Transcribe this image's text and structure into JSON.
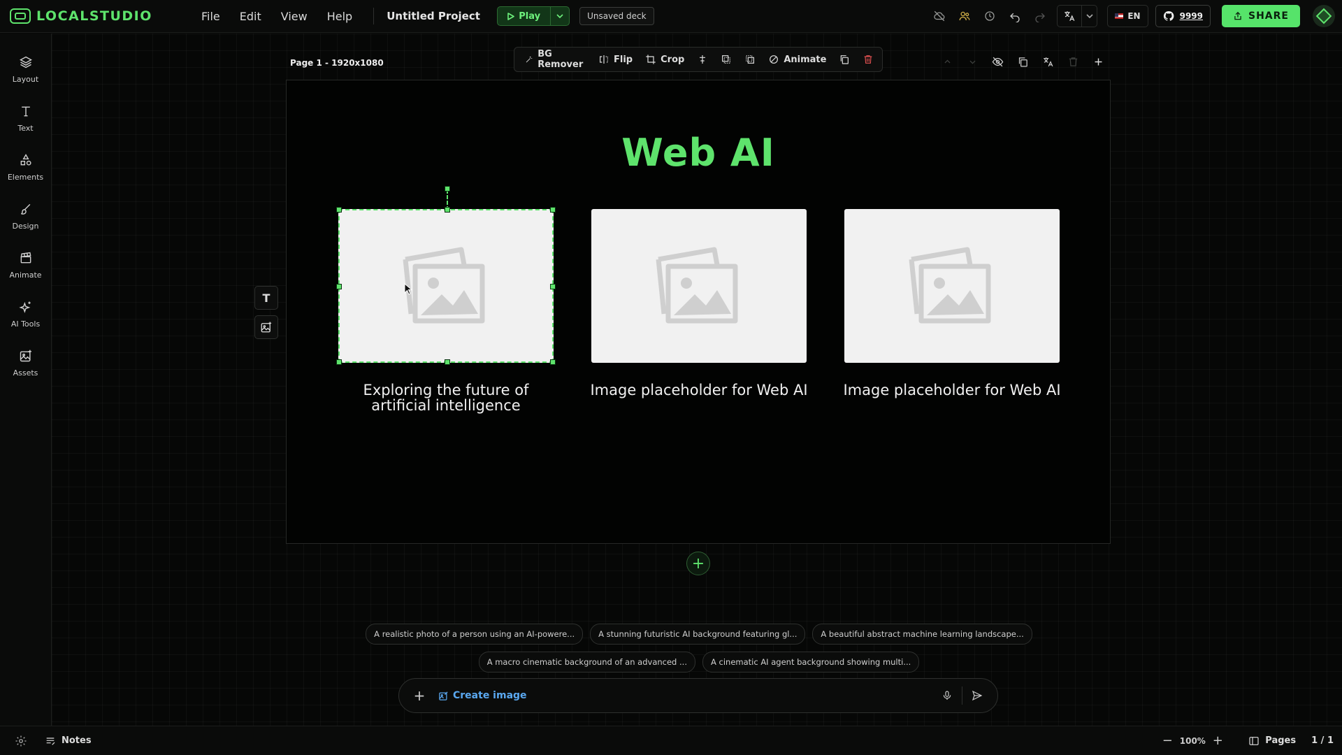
{
  "app": {
    "logo_text": "LOCALSTUDIO",
    "menu": [
      "File",
      "Edit",
      "View",
      "Help"
    ],
    "project_title": "Untitled Project",
    "play_label": "Play",
    "unsaved_label": "Unsaved deck",
    "locale_label": "EN",
    "github_count": "9999",
    "share_label": "SHARE"
  },
  "sidebar": {
    "items": [
      {
        "label": "Layout",
        "icon": "layers-icon"
      },
      {
        "label": "Text",
        "icon": "text-icon"
      },
      {
        "label": "Elements",
        "icon": "shapes-icon"
      },
      {
        "label": "Design",
        "icon": "brush-icon"
      },
      {
        "label": "Animate",
        "icon": "clapper-icon"
      },
      {
        "label": "AI Tools",
        "icon": "sparkles-icon"
      },
      {
        "label": "Assets",
        "icon": "image-plus-icon"
      }
    ]
  },
  "canvas": {
    "page_label": "Page 1 - 1920x1080",
    "toolbar": {
      "bg_remover": "BG Remover",
      "flip": "Flip",
      "crop": "Crop",
      "animate": "Animate"
    }
  },
  "slide": {
    "title": "Web AI",
    "cards": [
      {
        "caption": "Exploring the future of artificial intelligence"
      },
      {
        "caption": "Image placeholder for Web AI"
      },
      {
        "caption": "Image placeholder for Web AI"
      }
    ]
  },
  "prompt": {
    "suggestions_row1": [
      "A realistic photo of a person using an AI-powere...",
      "A stunning futuristic AI background featuring gl...",
      "A beautiful abstract machine learning landscape..."
    ],
    "suggestions_row2": [
      "A macro cinematic background of an advanced ...",
      "A cinematic AI agent background showing multi..."
    ],
    "create_label": "Create image"
  },
  "bottom": {
    "notes_label": "Notes",
    "zoom": "100%",
    "pages_label": "Pages",
    "page_count": "1 / 1"
  },
  "colors": {
    "accent": "#5ee36c",
    "background": "#060706",
    "link": "#5aa8f0",
    "danger": "#e05050"
  }
}
